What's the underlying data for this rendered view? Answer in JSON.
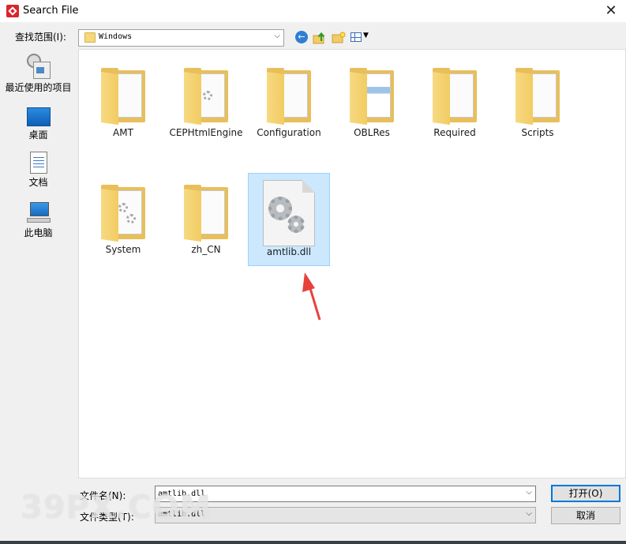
{
  "window": {
    "title": "Search File",
    "close_glyph": "✕",
    "icon": "app-logo-icon"
  },
  "toolbar": {
    "lookin_label": "查找范围(I):",
    "lookin_value": "Windows",
    "buttons": [
      "back-icon",
      "up-folder-icon",
      "new-folder-icon",
      "view-menu-icon"
    ]
  },
  "places": [
    {
      "label": "最近使用的项目",
      "icon": "recent-items-icon"
    },
    {
      "label": "桌面",
      "icon": "desktop-icon"
    },
    {
      "label": "文档",
      "icon": "documents-icon"
    },
    {
      "label": "此电脑",
      "icon": "this-pc-icon"
    }
  ],
  "files": [
    {
      "name": "AMT",
      "kind": "folder"
    },
    {
      "name": "CEPHtmlEngine",
      "kind": "folder"
    },
    {
      "name": "Configuration",
      "kind": "folder"
    },
    {
      "name": "OBLRes",
      "kind": "folder"
    },
    {
      "name": "Required",
      "kind": "folder"
    },
    {
      "name": "Scripts",
      "kind": "folder"
    },
    {
      "name": "System",
      "kind": "folder"
    },
    {
      "name": "zh_CN",
      "kind": "folder"
    },
    {
      "name": "amtlib.dll",
      "kind": "file",
      "selected": true
    }
  ],
  "footer": {
    "filename_label": "文件名(N):",
    "filename_value": "amtlib.dll",
    "filetype_label": "文件类型(T):",
    "filetype_value": "amtlib.dll",
    "open_button": "打开(O)",
    "cancel_button": "取消"
  },
  "watermark": "39PX.COM",
  "colors": {
    "selection": "#cce8ff",
    "folder": "#f2cc63",
    "accent": "#0078d7",
    "annotation_arrow": "#e8413c"
  }
}
